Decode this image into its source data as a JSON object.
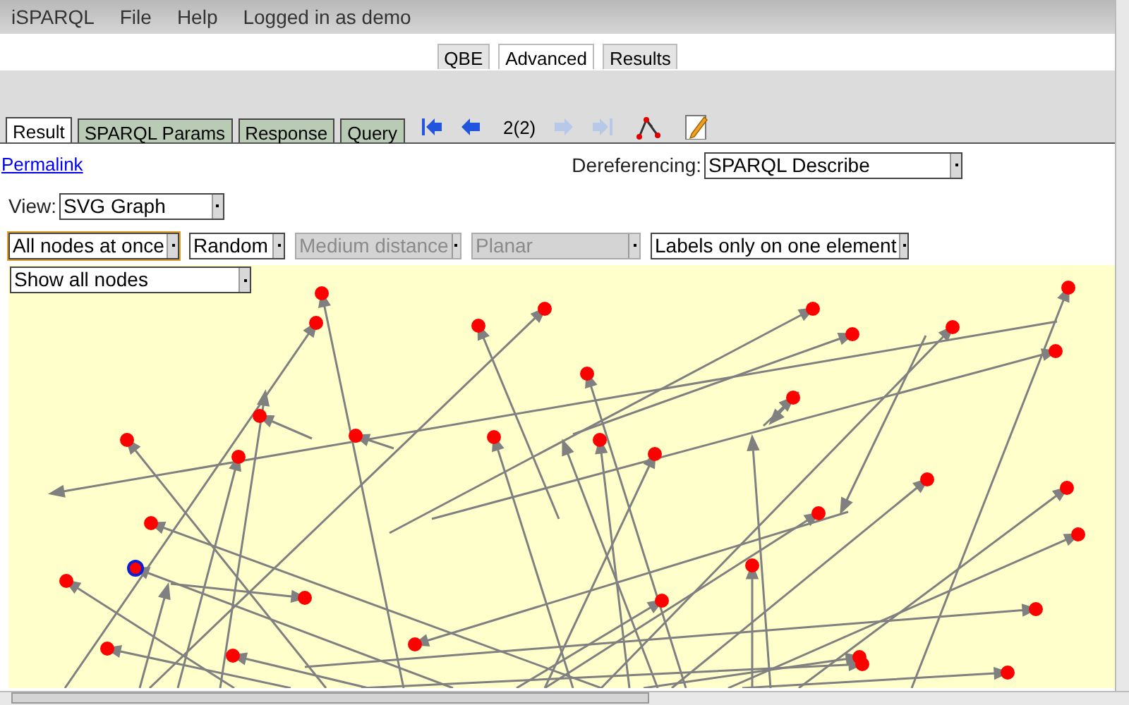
{
  "menu": [
    {
      "label": "iSPARQL"
    },
    {
      "label": "File"
    },
    {
      "label": "Help"
    },
    {
      "label": "Logged in as demo"
    }
  ],
  "top_tabs": [
    {
      "label": "QBE",
      "selected": false
    },
    {
      "label": "Advanced",
      "selected": true
    },
    {
      "label": "Results",
      "selected": false
    }
  ],
  "result_tabs": [
    {
      "label": "Result",
      "selected": true
    },
    {
      "label": "SPARQL Params",
      "selected": false
    },
    {
      "label": "Response",
      "selected": false
    },
    {
      "label": "Query",
      "selected": false
    }
  ],
  "pager": {
    "text": "2(2)",
    "prev_enabled": true,
    "next_enabled": false
  },
  "permalink": "Permalink",
  "dereferencing": {
    "label": "Dereferencing:",
    "value": "SPARQL Describe"
  },
  "view": {
    "label": "View:",
    "value": "SVG Graph"
  },
  "options": [
    {
      "value": "All nodes at once",
      "disabled": false,
      "focused": true
    },
    {
      "value": "Random",
      "disabled": false,
      "focused": false
    },
    {
      "value": "Medium distance",
      "disabled": true,
      "focused": false
    },
    {
      "value": "Planar",
      "disabled": true,
      "focused": false
    },
    {
      "value": "Labels only on one element",
      "disabled": false,
      "focused": false
    }
  ],
  "filter": {
    "value": "Show all nodes"
  }
}
